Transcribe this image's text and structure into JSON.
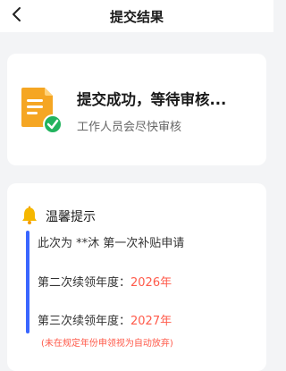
{
  "header": {
    "title": "提交结果"
  },
  "result": {
    "title": "提交成功，等待审核...",
    "subtitle": "工作人员会尽快审核"
  },
  "tips": {
    "title": "温馨提示",
    "row1": "此次为 **沐 第一次补贴申请",
    "row2_label": "第二次续领年度：",
    "row2_value": "2026年",
    "row3_label": "第三次续领年度：",
    "row3_value": "2027年",
    "note": "(未在规定年份申领视为自动放弃)"
  },
  "colors": {
    "accent": "#3a66ff",
    "warning": "#ff5a4a",
    "success": "#22b35e",
    "doc": "#f5a623"
  }
}
